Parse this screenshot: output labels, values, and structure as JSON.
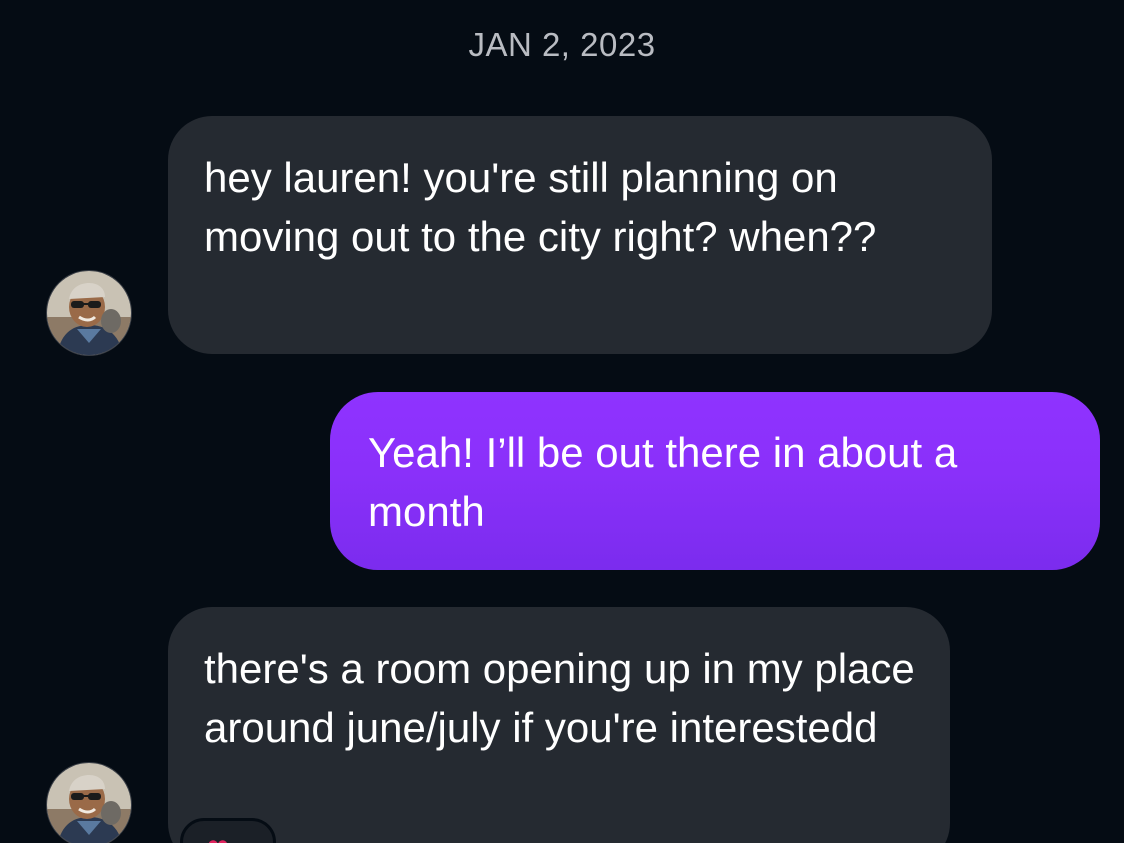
{
  "conversation": {
    "date_header": "JAN 2, 2023",
    "messages": [
      {
        "direction": "incoming",
        "sender_avatar": "contact-avatar-photo",
        "text": "hey lauren! you're still planning on moving out to the city right? when??"
      },
      {
        "direction": "outgoing",
        "text": "Yeah! I’ll be out there in about a month"
      },
      {
        "direction": "incoming",
        "sender_avatar": "contact-avatar-photo",
        "text": "there's a room opening up in my place around june/july if you're interestedd",
        "reaction_icon": "heart-icon"
      }
    ]
  },
  "colors": {
    "background": "#050c14",
    "incoming_bubble": "#252a31",
    "outgoing_bubble": "#8a30fa",
    "date_text": "#b9bcc2",
    "message_text": "#ffffff"
  }
}
